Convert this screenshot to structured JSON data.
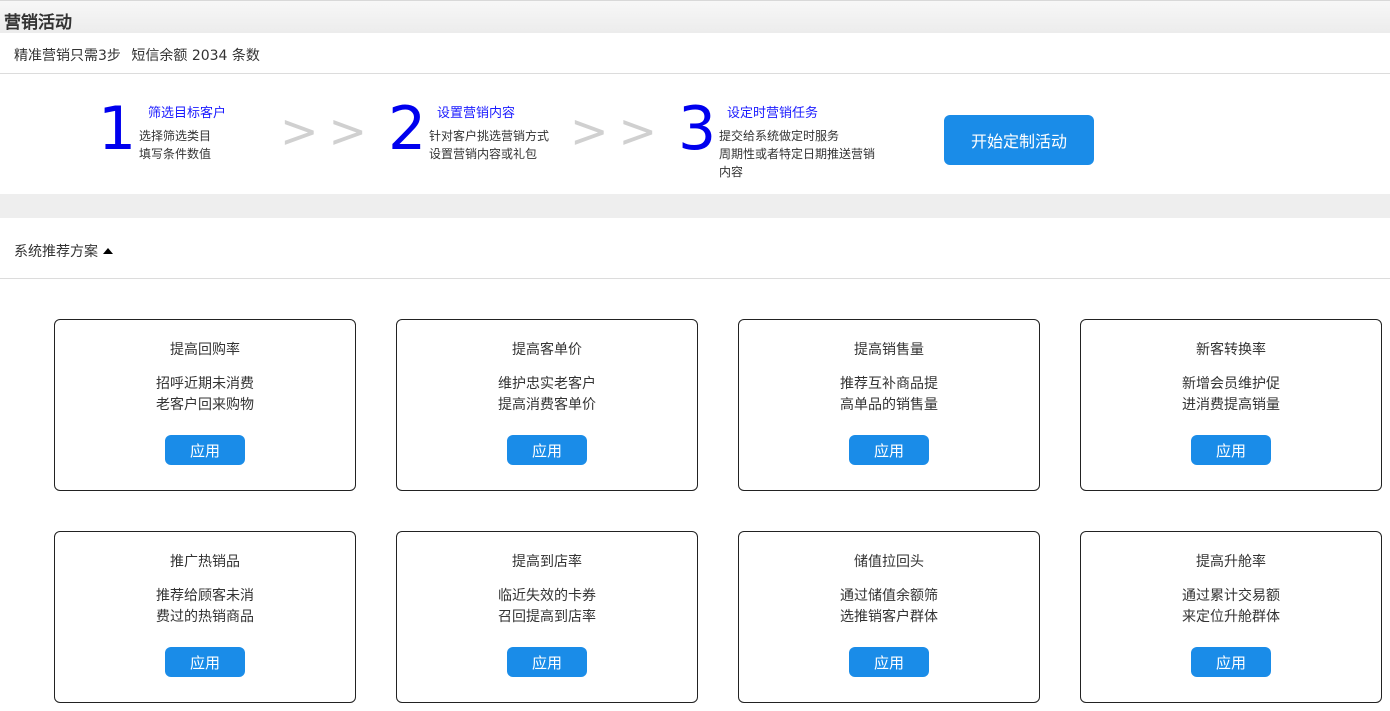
{
  "header": {
    "title": "营销活动"
  },
  "intro": {
    "text": "精准营销只需3步",
    "sms_balance": "短信余额 2034 条数"
  },
  "steps": [
    {
      "number": "1",
      "title": "筛选目标客户",
      "lines": [
        "选择筛选类目",
        "填写条件数值"
      ]
    },
    {
      "number": "2",
      "title": "设置营销内容",
      "lines": [
        "针对客户挑选营销方式",
        "设置营销内容或礼包"
      ]
    },
    {
      "number": "3",
      "title": "设定时营销任务",
      "lines": [
        "提交给系统做定时服务",
        "周期性或者特定日期推送营销",
        "内容"
      ]
    }
  ],
  "arrow_text": ">>",
  "start_button": "开始定制活动",
  "section": {
    "label": "系统推荐方案"
  },
  "cards": [
    {
      "title": "提高回购率",
      "lines": [
        "招呼近期未消费",
        "老客户回来购物"
      ],
      "button": "应用"
    },
    {
      "title": "提高客单价",
      "lines": [
        "维护忠实老客户",
        "提高消费客单价"
      ],
      "button": "应用"
    },
    {
      "title": "提高销售量",
      "lines": [
        "推荐互补商品提",
        "高单品的销售量"
      ],
      "button": "应用"
    },
    {
      "title": "新客转换率",
      "lines": [
        "新增会员维护促",
        "进消费提高销量"
      ],
      "button": "应用"
    },
    {
      "title": "推广热销品",
      "lines": [
        "推荐给顾客未消",
        "费过的热销商品"
      ],
      "button": "应用"
    },
    {
      "title": "提高到店率",
      "lines": [
        "临近失效的卡券",
        "召回提高到店率"
      ],
      "button": "应用"
    },
    {
      "title": "储值拉回头",
      "lines": [
        "通过储值余额筛",
        "选推销客户群体"
      ],
      "button": "应用"
    },
    {
      "title": "提高升舱率",
      "lines": [
        "通过累计交易额",
        "来定位升舱群体"
      ],
      "button": "应用"
    }
  ],
  "colors": {
    "accent": "#1a8ce8",
    "step_number": "#0000ee",
    "step_title": "#1a1aff"
  }
}
